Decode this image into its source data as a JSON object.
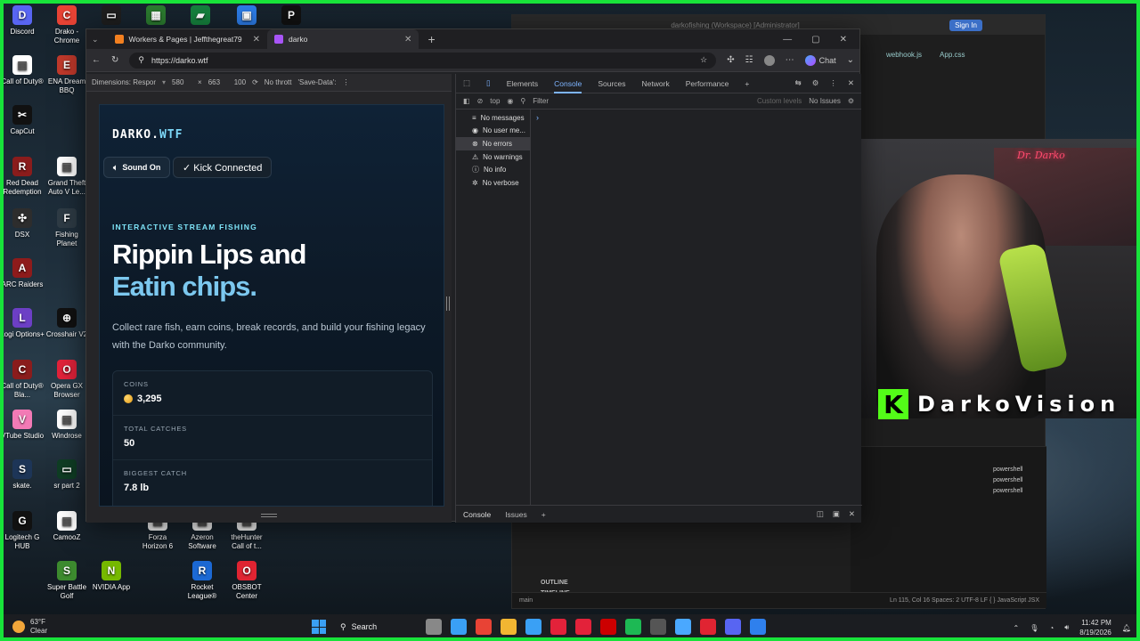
{
  "desktop": {
    "icons": [
      {
        "label": "Discord",
        "color": "#5865f2",
        "glyph": "D"
      },
      {
        "label": "Drako - Chrome",
        "color": "#e84335",
        "glyph": "C"
      },
      {
        "label": "",
        "color": "#1e1e1e",
        "glyph": "▭"
      },
      {
        "label": "",
        "color": "#2b7a2f",
        "glyph": "▦"
      },
      {
        "label": "",
        "color": "#15803d",
        "glyph": "▰"
      },
      {
        "label": "",
        "color": "#2c7be5",
        "glyph": "▣"
      },
      {
        "label": "",
        "color": "#111",
        "glyph": "P"
      },
      {
        "label": "Call of Duty®",
        "color": "#ffffff",
        "glyph": "▤"
      },
      {
        "label": "ENA Dream BBQ",
        "color": "#c0392b",
        "glyph": "E"
      },
      {
        "label": "CapCut",
        "color": "#111",
        "glyph": "✂"
      },
      {
        "label": "Red Dead Redemption",
        "color": "#8a1c1c",
        "glyph": "R"
      },
      {
        "label": "Grand Theft Auto V Le...",
        "color": "#ffffff",
        "glyph": "▤"
      },
      {
        "label": "DSX",
        "color": "#2d2d2d",
        "glyph": "✣"
      },
      {
        "label": "Fishing Planet",
        "color": "#2e3b45",
        "glyph": "F"
      },
      {
        "label": "ARC Raiders",
        "color": "#8e1b1b",
        "glyph": "A"
      },
      {
        "label": "Logi Options+",
        "color": "#6c3fc5",
        "glyph": "L"
      },
      {
        "label": "Crosshair V2",
        "color": "#111",
        "glyph": "⊕"
      },
      {
        "label": "Call of Duty® Bla...",
        "color": "#8a1c1c",
        "glyph": "C"
      },
      {
        "label": "Opera GX Browser",
        "color": "#e3223a",
        "glyph": "O"
      },
      {
        "label": "VTube Studio",
        "color": "#f27ab5",
        "glyph": "V"
      },
      {
        "label": "Windrose",
        "color": "#ffffff",
        "glyph": "▤"
      },
      {
        "label": "skate.",
        "color": "#1d3557",
        "glyph": "S"
      },
      {
        "label": "sr part 2",
        "color": "#0f3d24",
        "glyph": "▭"
      },
      {
        "label": "Logitech G HUB",
        "color": "#111",
        "glyph": "G"
      },
      {
        "label": "CamooZ",
        "color": "#ffffff",
        "glyph": "▤"
      },
      {
        "label": "Forza Horizon 6",
        "color": "#ffffff",
        "glyph": "▤"
      },
      {
        "label": "Azeron Software",
        "color": "#ffffff",
        "glyph": "▤"
      },
      {
        "label": "theHunter Call of t...",
        "color": "#ffffff",
        "glyph": "▤"
      },
      {
        "label": "Super Battle Golf",
        "color": "#3c8a2e",
        "glyph": "S"
      },
      {
        "label": "NVIDIA App",
        "color": "#76b900",
        "glyph": "N"
      },
      {
        "label": "Rocket League®",
        "color": "#1c69d4",
        "glyph": "R"
      },
      {
        "label": "OBSBOT Center",
        "color": "#e02432",
        "glyph": "O"
      }
    ]
  },
  "vscode": {
    "title": "darkofishing (Workspace) [Administrator]",
    "signin": "Sign In",
    "tabs": [
      "webhook.js",
      "App.css"
    ],
    "terminals": [
      "powershell",
      "powershell",
      "powershell"
    ],
    "outline": "OUTLINE",
    "timeline": "TIMELINE",
    "status_left": "main",
    "status_right": "Ln 115, Col 16   Spaces: 2   UTF-8   LF   { } JavaScript JSX"
  },
  "stream": {
    "neon": "Dr. Darko",
    "brand_letter": "K",
    "brand": "DarkoVision"
  },
  "chrome": {
    "tabs": [
      {
        "label": "Workers & Pages | Jeffthegreat79",
        "color": "#f38020"
      },
      {
        "label": "darko",
        "color": "#a855f7"
      }
    ],
    "url": "https://darko.wtf",
    "chat": "Chat",
    "device_toolbar": {
      "dimensions": "Dimensions: Respor",
      "width": "580",
      "height": "663",
      "zoom": "100",
      "throttle": "No thrott",
      "save_data": "'Save-Data':"
    }
  },
  "site": {
    "logo_main": "DARKO.",
    "logo_accent": "WTF",
    "sound_btn": "Sound On",
    "kick_btn": "✓ Kick Connected",
    "eyebrow": "INTERACTIVE STREAM FISHING",
    "hero_line1": "Rippin Lips and",
    "hero_line2": "Eatin chips.",
    "lead": "Collect rare fish, earn coins, break records, and build your fishing legacy with the Darko community.",
    "stats": [
      {
        "label": "COINS",
        "value": "3,295",
        "coin": true
      },
      {
        "label": "TOTAL CATCHES",
        "value": "50",
        "coin": false
      },
      {
        "label": "BIGGEST CATCH",
        "value": "7.8 lb",
        "coin": false
      }
    ]
  },
  "devtools": {
    "tabs": [
      "Elements",
      "Console",
      "Sources",
      "Network",
      "Performance"
    ],
    "active_tab": "Console",
    "context": "top",
    "filter_placeholder": "Filter",
    "levels": "Custom levels",
    "issues": "No Issues",
    "sidebar": [
      {
        "label": "No messages",
        "icon": "≡"
      },
      {
        "label": "No user me...",
        "icon": "◉"
      },
      {
        "label": "No errors",
        "icon": "⊗"
      },
      {
        "label": "No warnings",
        "icon": "⚠"
      },
      {
        "label": "No info",
        "icon": "ⓘ"
      },
      {
        "label": "No verbose",
        "icon": "✲"
      }
    ],
    "selected_index": 2,
    "drawer_tabs": [
      "Console",
      "Issues"
    ]
  },
  "taskbar": {
    "temp": "63°F",
    "weather": "Clear",
    "search": "Search",
    "time": "11:42 PM",
    "date": "8/19/2026",
    "apps": [
      "#888",
      "#3aa0f5",
      "#e84335",
      "#f2b632",
      "#3aa0f5",
      "#e3223a",
      "#e3223a",
      "#c00",
      "#1db954",
      "#555",
      "#4aa8ff",
      "#e02432",
      "#5865f2",
      "#2f80ed"
    ]
  }
}
